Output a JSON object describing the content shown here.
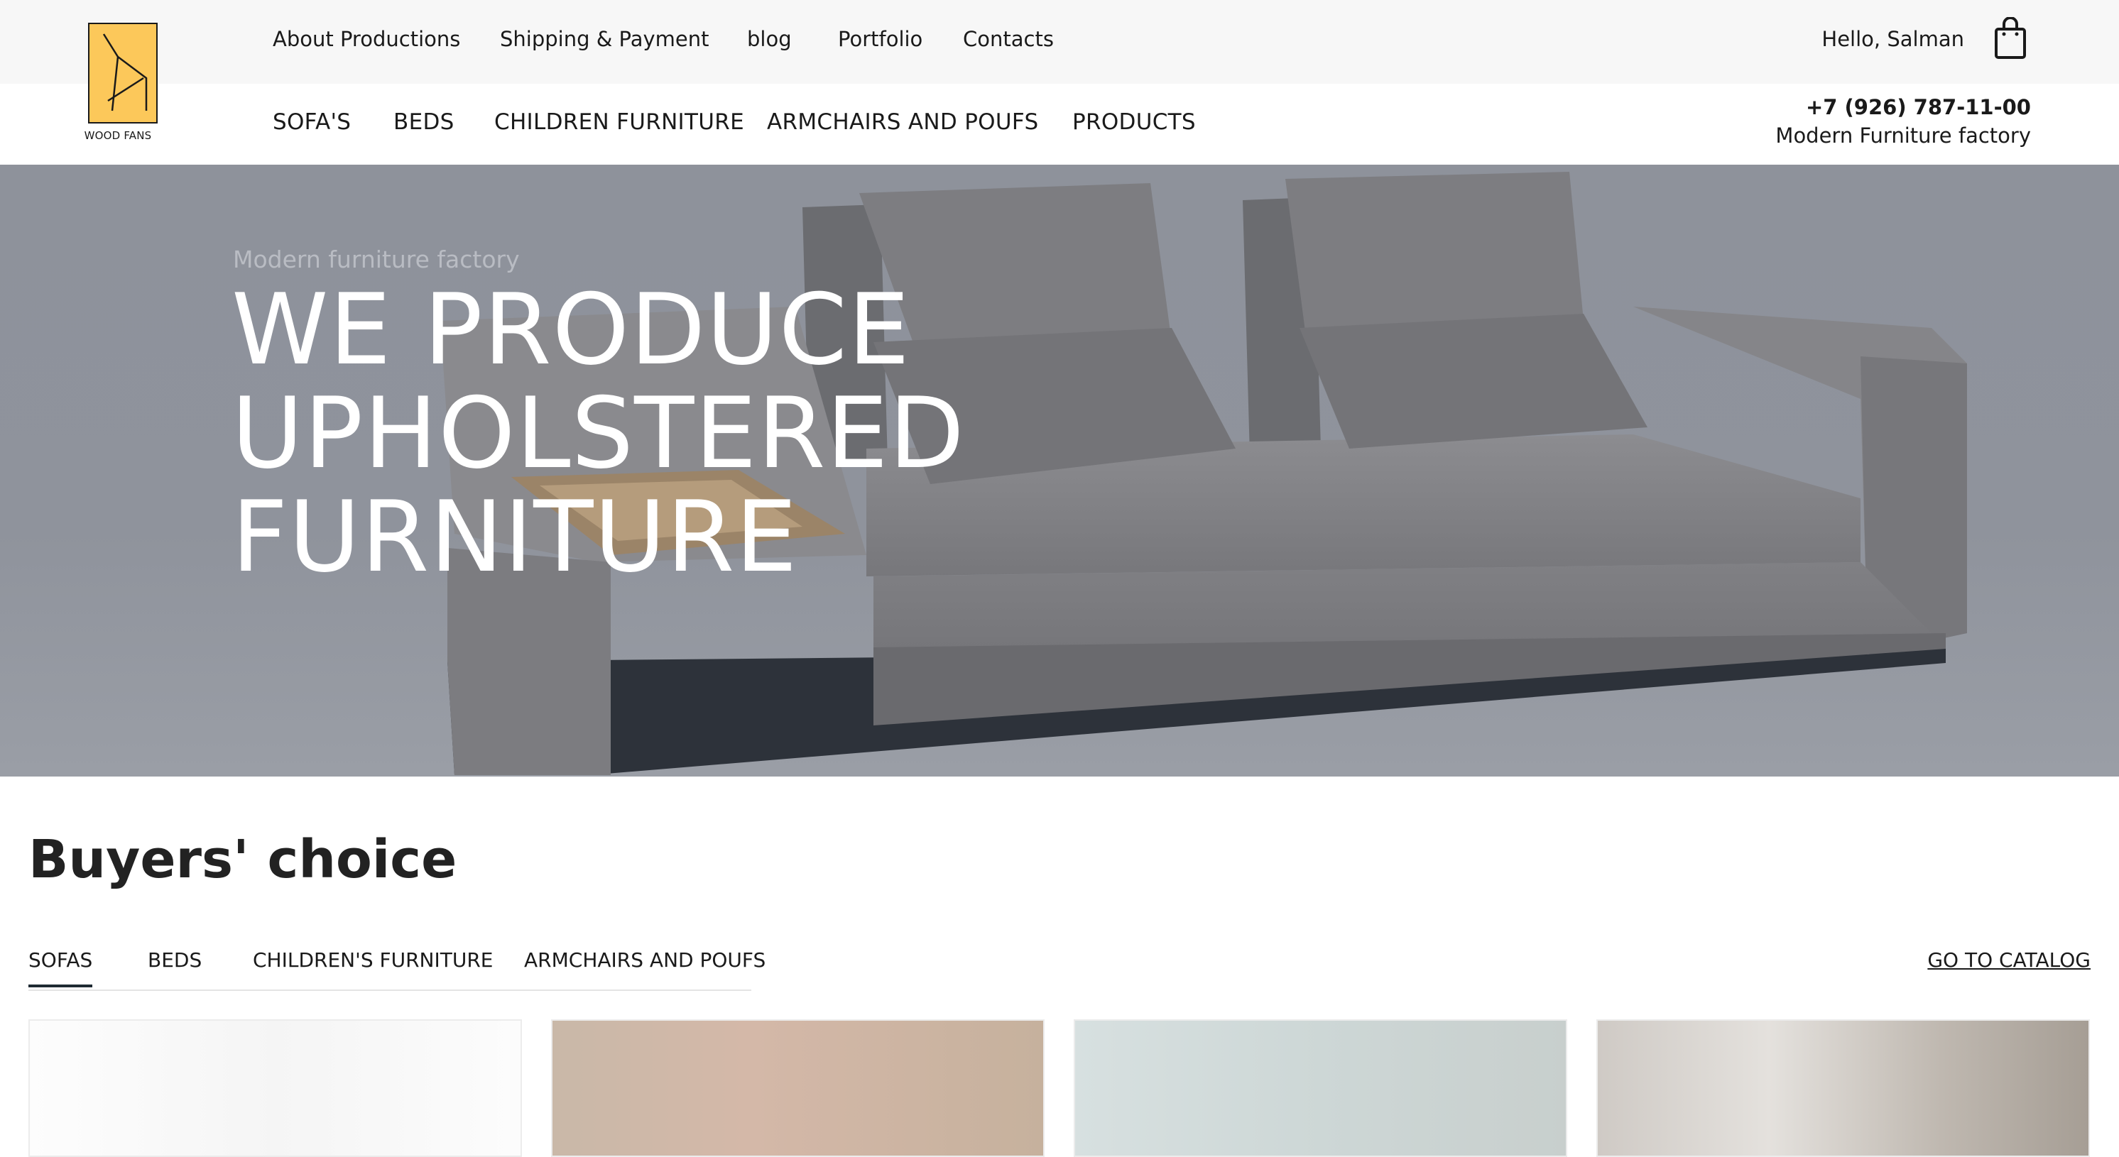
{
  "brand": {
    "logo_text": "WOOD FANS",
    "logo_color": "#fcc85a"
  },
  "top_nav": [
    {
      "label": "About Productions"
    },
    {
      "label": "Shipping & Payment"
    },
    {
      "label": "blog"
    },
    {
      "label": "Portfolio"
    },
    {
      "label": "Contacts"
    }
  ],
  "user": {
    "greeting": "Hello, Salman",
    "cart_icon": "shopping-bag-icon"
  },
  "main_nav": [
    {
      "label": "SOFA'S"
    },
    {
      "label": "BEDS"
    },
    {
      "label": "CHILDREN FURNITURE"
    },
    {
      "label": "ARMCHAIRS AND POUFS"
    },
    {
      "label": "PRODUCTS"
    }
  ],
  "contact": {
    "phone": "+7 (926) 787-11-00",
    "tagline": "Modern Furniture factory"
  },
  "hero": {
    "kicker": "Modern furniture factory",
    "title_lines": [
      "WE PRODUCE",
      "UPHOLSTERED",
      "FURNITURE"
    ]
  },
  "buyers_choice": {
    "title": "Buyers' choice",
    "tabs": [
      {
        "label": "SOFAS",
        "active": true
      },
      {
        "label": "BEDS",
        "active": false
      },
      {
        "label": "CHILDREN'S FURNITURE",
        "active": false
      },
      {
        "label": "ARMCHAIRS AND POUFS",
        "active": false
      }
    ],
    "catalog_link": "GO TO CATALOG"
  }
}
